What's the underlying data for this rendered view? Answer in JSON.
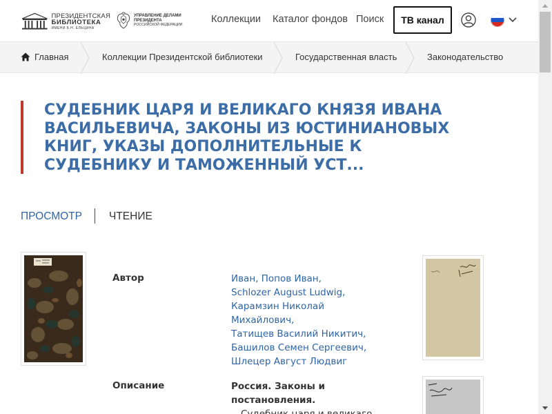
{
  "header": {
    "logo_library": {
      "line1": "ПРЕЗИДЕНТСКАЯ",
      "line2": "БИБЛИОТЕКА",
      "line3": "ИМЕНИ Б.Н. ЕЛЬЦИНА"
    },
    "logo_admin": {
      "line1": "УПРАВЛЕНИЕ ДЕЛАМИ ПРЕЗИДЕНТА",
      "line2": "РОССИЙСКОЙ ФЕДЕРАЦИИ"
    },
    "nav": {
      "collections": "Коллекции",
      "catalog": "Каталог фондов",
      "search": "Поиск"
    },
    "tv_button": "ТВ канал",
    "icons": {
      "user": "user-icon",
      "language": "russian-flag-icon",
      "dropdown": "chevron-down-icon"
    }
  },
  "breadcrumb": {
    "items": [
      "Главная",
      "Коллекции Президентской библиотеки",
      "Государственная власть",
      "Законодательство"
    ]
  },
  "document": {
    "title": "Судебник царя и великаго князя Ивана Васильевича, законы из Юстиниановых книг, указы дополнительные к Судебнику и таможенный уст..."
  },
  "tabs": {
    "view": "ПРОСМОТР",
    "read": "ЧТЕНИЕ"
  },
  "metadata": {
    "author_label": "Автор",
    "authors": [
      "Иван, Попов Иван,",
      "Schlozer August Ludwig,",
      "Карамзин Николай",
      "Михайлович,",
      "Татищев Василий Никитич,",
      "Башилов Семен Сергеевич,",
      "Шлецер Август Людвиг"
    ],
    "description_label": "Описание",
    "description_bold": [
      "Россия. Законы и",
      "постановления."
    ],
    "description_rest": "Судебник царя и великаго"
  },
  "colors": {
    "title": "#3d6da6",
    "accent_bar": "#c0392b",
    "link": "#2e64a5",
    "breadcrumb_bg": "#f4f4f4"
  }
}
